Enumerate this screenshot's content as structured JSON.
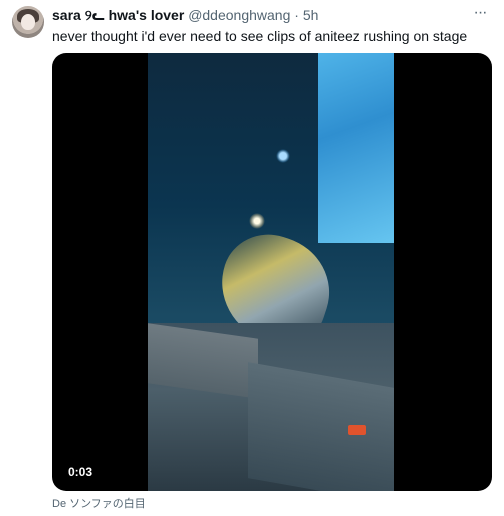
{
  "tweet": {
    "display_name": "sara ୨ᓚ hwa's lover",
    "handle": "@ddeonghwang",
    "separator": "·",
    "time": "5h",
    "more_label": "···",
    "text": "never thought i'd ever need to see clips of aniteez rushing on stage"
  },
  "video": {
    "timestamp": "0:03"
  },
  "caption": "De ソンファの白目"
}
